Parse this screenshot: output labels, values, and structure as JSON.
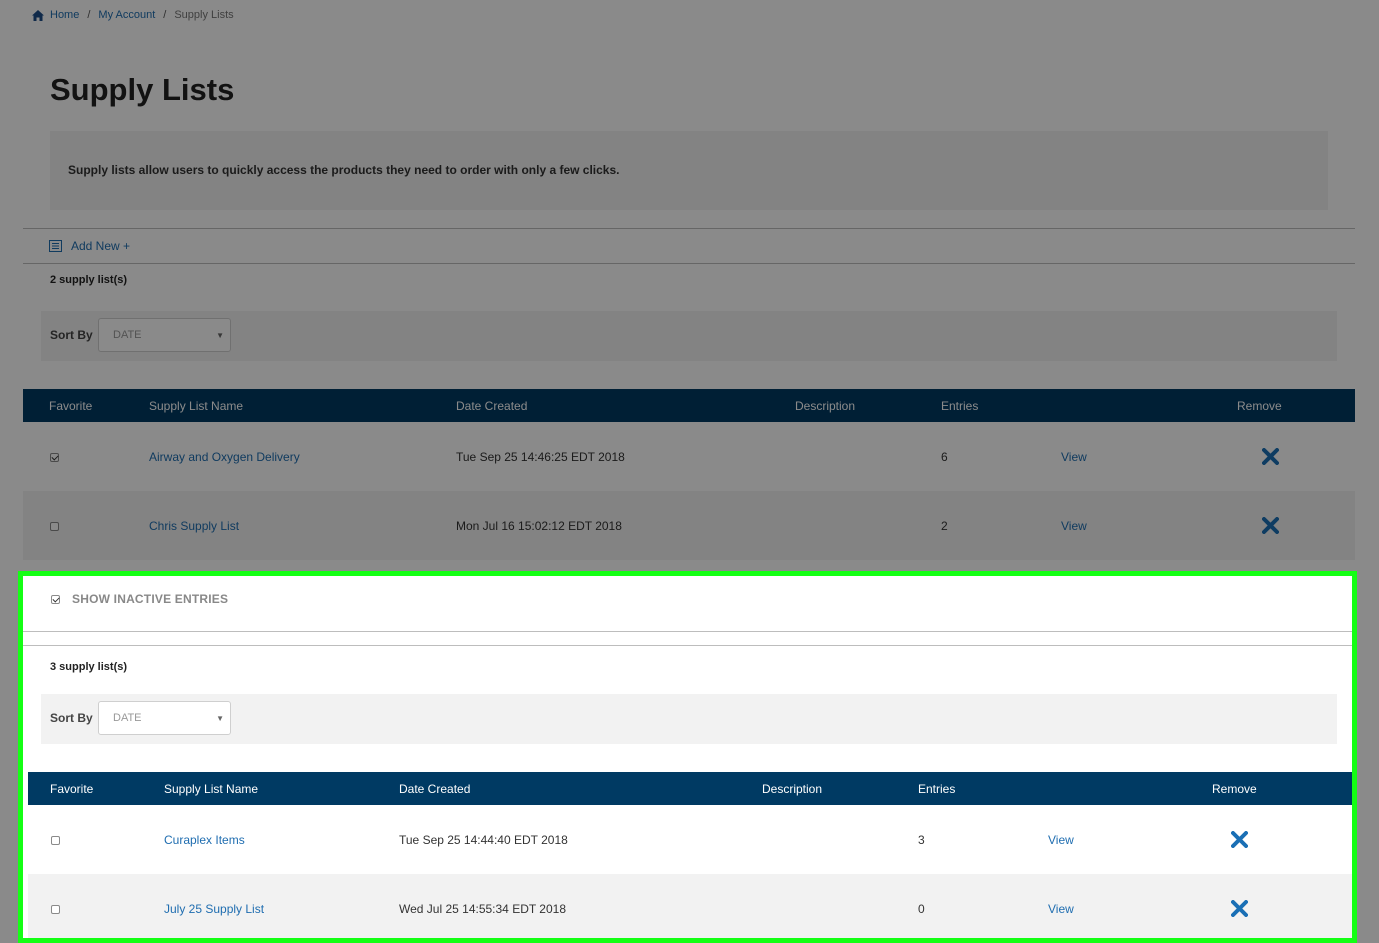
{
  "breadcrumb": {
    "home": "Home",
    "sep1": "/",
    "my_account": "My Account",
    "sep2": "/",
    "current": "Supply Lists"
  },
  "page": {
    "title": "Supply Lists",
    "intro": "Supply lists allow users to quickly access the products they need to order with only a few clicks.",
    "add_new": "Add New +"
  },
  "active": {
    "count": "2 supply list(s)",
    "sort_label": "Sort By",
    "sort_value": "DATE",
    "headers": [
      "Favorite",
      "Supply List Name",
      "Date Created",
      "Description",
      "Entries",
      "",
      "Remove"
    ],
    "rows": [
      {
        "favorite": true,
        "name": "Airway and Oxygen Delivery",
        "date": "Tue Sep 25 14:46:25 EDT 2018",
        "description": "",
        "entries": "6",
        "view": "View"
      },
      {
        "favorite": false,
        "name": "Chris Supply List",
        "date": "Mon Jul 16 15:02:12 EDT 2018",
        "description": "",
        "entries": "2",
        "view": "View"
      }
    ]
  },
  "inactive": {
    "show_label": "SHOW INACTIVE ENTRIES",
    "show_checked": true,
    "count": "3 supply list(s)",
    "sort_label": "Sort By",
    "sort_value": "DATE",
    "headers": [
      "Favorite",
      "Supply List Name",
      "Date Created",
      "Description",
      "Entries",
      "",
      "Remove"
    ],
    "rows": [
      {
        "favorite": false,
        "name": "Curaplex Items",
        "date": "Tue Sep 25 14:44:40 EDT 2018",
        "description": "",
        "entries": "3",
        "view": "View"
      },
      {
        "favorite": false,
        "name": "July 25 Supply List",
        "date": "Wed Jul 25 14:55:34 EDT 2018",
        "description": "",
        "entries": "0",
        "view": "View"
      }
    ]
  },
  "colors": {
    "header_bg": "#003a63",
    "link": "#1f6db0",
    "remove_icon": "#1a6fb5",
    "highlight_border": "#14ff14"
  },
  "icons": {
    "home": "home-icon",
    "add_new": "list-icon",
    "remove": "close-x-icon",
    "sort_caret": "caret-down-icon"
  }
}
